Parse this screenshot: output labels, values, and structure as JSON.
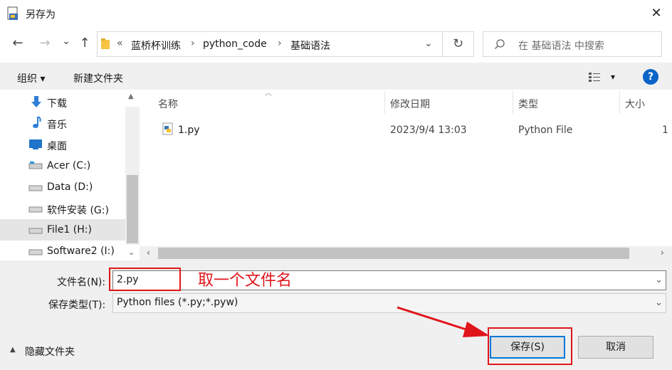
{
  "window": {
    "title": "另存为",
    "close_symbol": "✕"
  },
  "nav": {
    "back": "←",
    "forward": "→",
    "dropdown": "⌄",
    "up": "↑",
    "breadcrumb_prefix": "«",
    "breadcrumb": [
      "蓝桥杯训练",
      "python_code",
      "基础语法"
    ],
    "separator": "›",
    "address_dropdown": "⌄",
    "refresh": "↻",
    "search_placeholder": "在 基础语法 中搜索"
  },
  "toolbar": {
    "organize": "组织 ▾",
    "new_folder": "新建文件夹",
    "view_dropdown": "▾",
    "help": "?"
  },
  "sidebar": {
    "items": [
      {
        "label": "下载",
        "icon": "download-icon"
      },
      {
        "label": "音乐",
        "icon": "music-icon"
      },
      {
        "label": "桌面",
        "icon": "desktop-icon"
      },
      {
        "label": "Acer (C:)",
        "icon": "drive-icon"
      },
      {
        "label": "Data (D:)",
        "icon": "drive-icon"
      },
      {
        "label": "软件安装 (G:)",
        "icon": "drive-icon"
      },
      {
        "label": "File1 (H:)",
        "icon": "drive-icon",
        "selected": true
      },
      {
        "label": "Software2 (I:)",
        "icon": "drive-icon"
      }
    ]
  },
  "file_list": {
    "columns": [
      "名称",
      "修改日期",
      "类型",
      "大小"
    ],
    "rows": [
      {
        "name": "1.py",
        "modified": "2023/9/4 13:03",
        "type": "Python File",
        "size": "1"
      }
    ]
  },
  "form": {
    "filename_label": "文件名(N):",
    "filename_value": "2.py",
    "filetype_label": "保存类型(T):",
    "filetype_value": "Python files (*.py;*.pyw)"
  },
  "footer": {
    "hide_folders": "隐藏文件夹",
    "save_button": "保存(S)",
    "cancel_button": "取消"
  },
  "annotation": {
    "text": "取一个文件名",
    "color": "#e0151b"
  },
  "colors": {
    "accent": "#0078d7",
    "annotation_red": "#e0151b",
    "help_blue": "#0a64c8"
  }
}
